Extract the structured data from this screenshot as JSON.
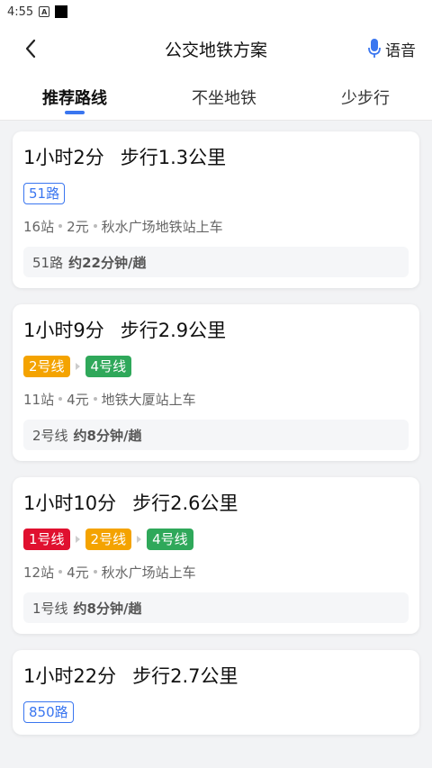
{
  "status_bar": {
    "time": "4:55",
    "icon_a": "A"
  },
  "header": {
    "title": "公交地铁方案",
    "voice_label": "语音",
    "mic_color": "#3a76f0"
  },
  "tabs": [
    {
      "label": "推荐路线",
      "active": true
    },
    {
      "label": "不坐地铁",
      "active": false
    },
    {
      "label": "少步行",
      "active": false
    }
  ],
  "colors": {
    "accent": "#3a76f0",
    "line1": "#e0102f",
    "line2": "#f4a300",
    "line4": "#2fa85a"
  },
  "routes": [
    {
      "duration": "1小时2分",
      "walk": "步行1.3公里",
      "lines": [
        {
          "name": "51路",
          "kind": "bus"
        }
      ],
      "stops": "16站",
      "fare": "2元",
      "board": "秋水广场地铁站上车",
      "freq_line": "51路",
      "freq_text": "约22分钟/趟"
    },
    {
      "duration": "1小时9分",
      "walk": "步行2.9公里",
      "lines": [
        {
          "name": "2号线",
          "kind": "metro",
          "color": "#f4a300"
        },
        {
          "name": "4号线",
          "kind": "metro",
          "color": "#2fa85a"
        }
      ],
      "stops": "11站",
      "fare": "4元",
      "board": "地铁大厦站上车",
      "freq_line": "2号线",
      "freq_text": "约8分钟/趟"
    },
    {
      "duration": "1小时10分",
      "walk": "步行2.6公里",
      "lines": [
        {
          "name": "1号线",
          "kind": "metro",
          "color": "#e0102f"
        },
        {
          "name": "2号线",
          "kind": "metro",
          "color": "#f4a300"
        },
        {
          "name": "4号线",
          "kind": "metro",
          "color": "#2fa85a"
        }
      ],
      "stops": "12站",
      "fare": "4元",
      "board": "秋水广场站上车",
      "freq_line": "1号线",
      "freq_text": "约8分钟/趟"
    },
    {
      "duration": "1小时22分",
      "walk": "步行2.7公里",
      "lines": [
        {
          "name": "850路",
          "kind": "bus"
        }
      ]
    }
  ]
}
